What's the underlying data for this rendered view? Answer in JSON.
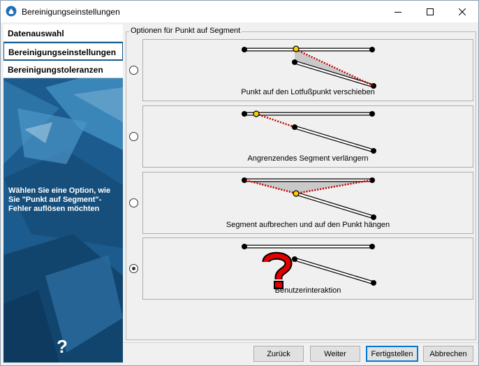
{
  "window": {
    "title": "Bereinigungseinstellungen"
  },
  "sidebar": {
    "items": [
      {
        "label": "Datenauswahl",
        "active": false
      },
      {
        "label": "Bereinigungseinstellungen",
        "active": true
      },
      {
        "label": "Bereinigungstoleranzen",
        "active": false
      }
    ],
    "instruction": "Wählen Sie eine Option, wie Sie \"Punkt auf Segment\"-Fehler auflösen möchten",
    "help_glyph": "?"
  },
  "group": {
    "label": "Optionen für Punkt auf Segment",
    "options": [
      {
        "label": "Punkt auf den Lotfußpunkt verschieben",
        "selected": false,
        "illustration": "move-point"
      },
      {
        "label": "Angrenzendes Segment verlängern",
        "selected": false,
        "illustration": "extend-segment"
      },
      {
        "label": "Segment aufbrechen und auf den Punkt hängen",
        "selected": false,
        "illustration": "break-segment"
      },
      {
        "label": "Benutzerinteraktion",
        "selected": true,
        "illustration": "question-mark"
      }
    ]
  },
  "footer": {
    "back_label": "Zurück",
    "next_label": "Weiter",
    "finish_label": "Fertigstellen",
    "cancel_label": "Abbrechen"
  },
  "colors": {
    "accent": "#0078d7",
    "sidebar": "#1d5f92",
    "point_yellow": "#f2d000",
    "dotted_red": "#c00000"
  }
}
